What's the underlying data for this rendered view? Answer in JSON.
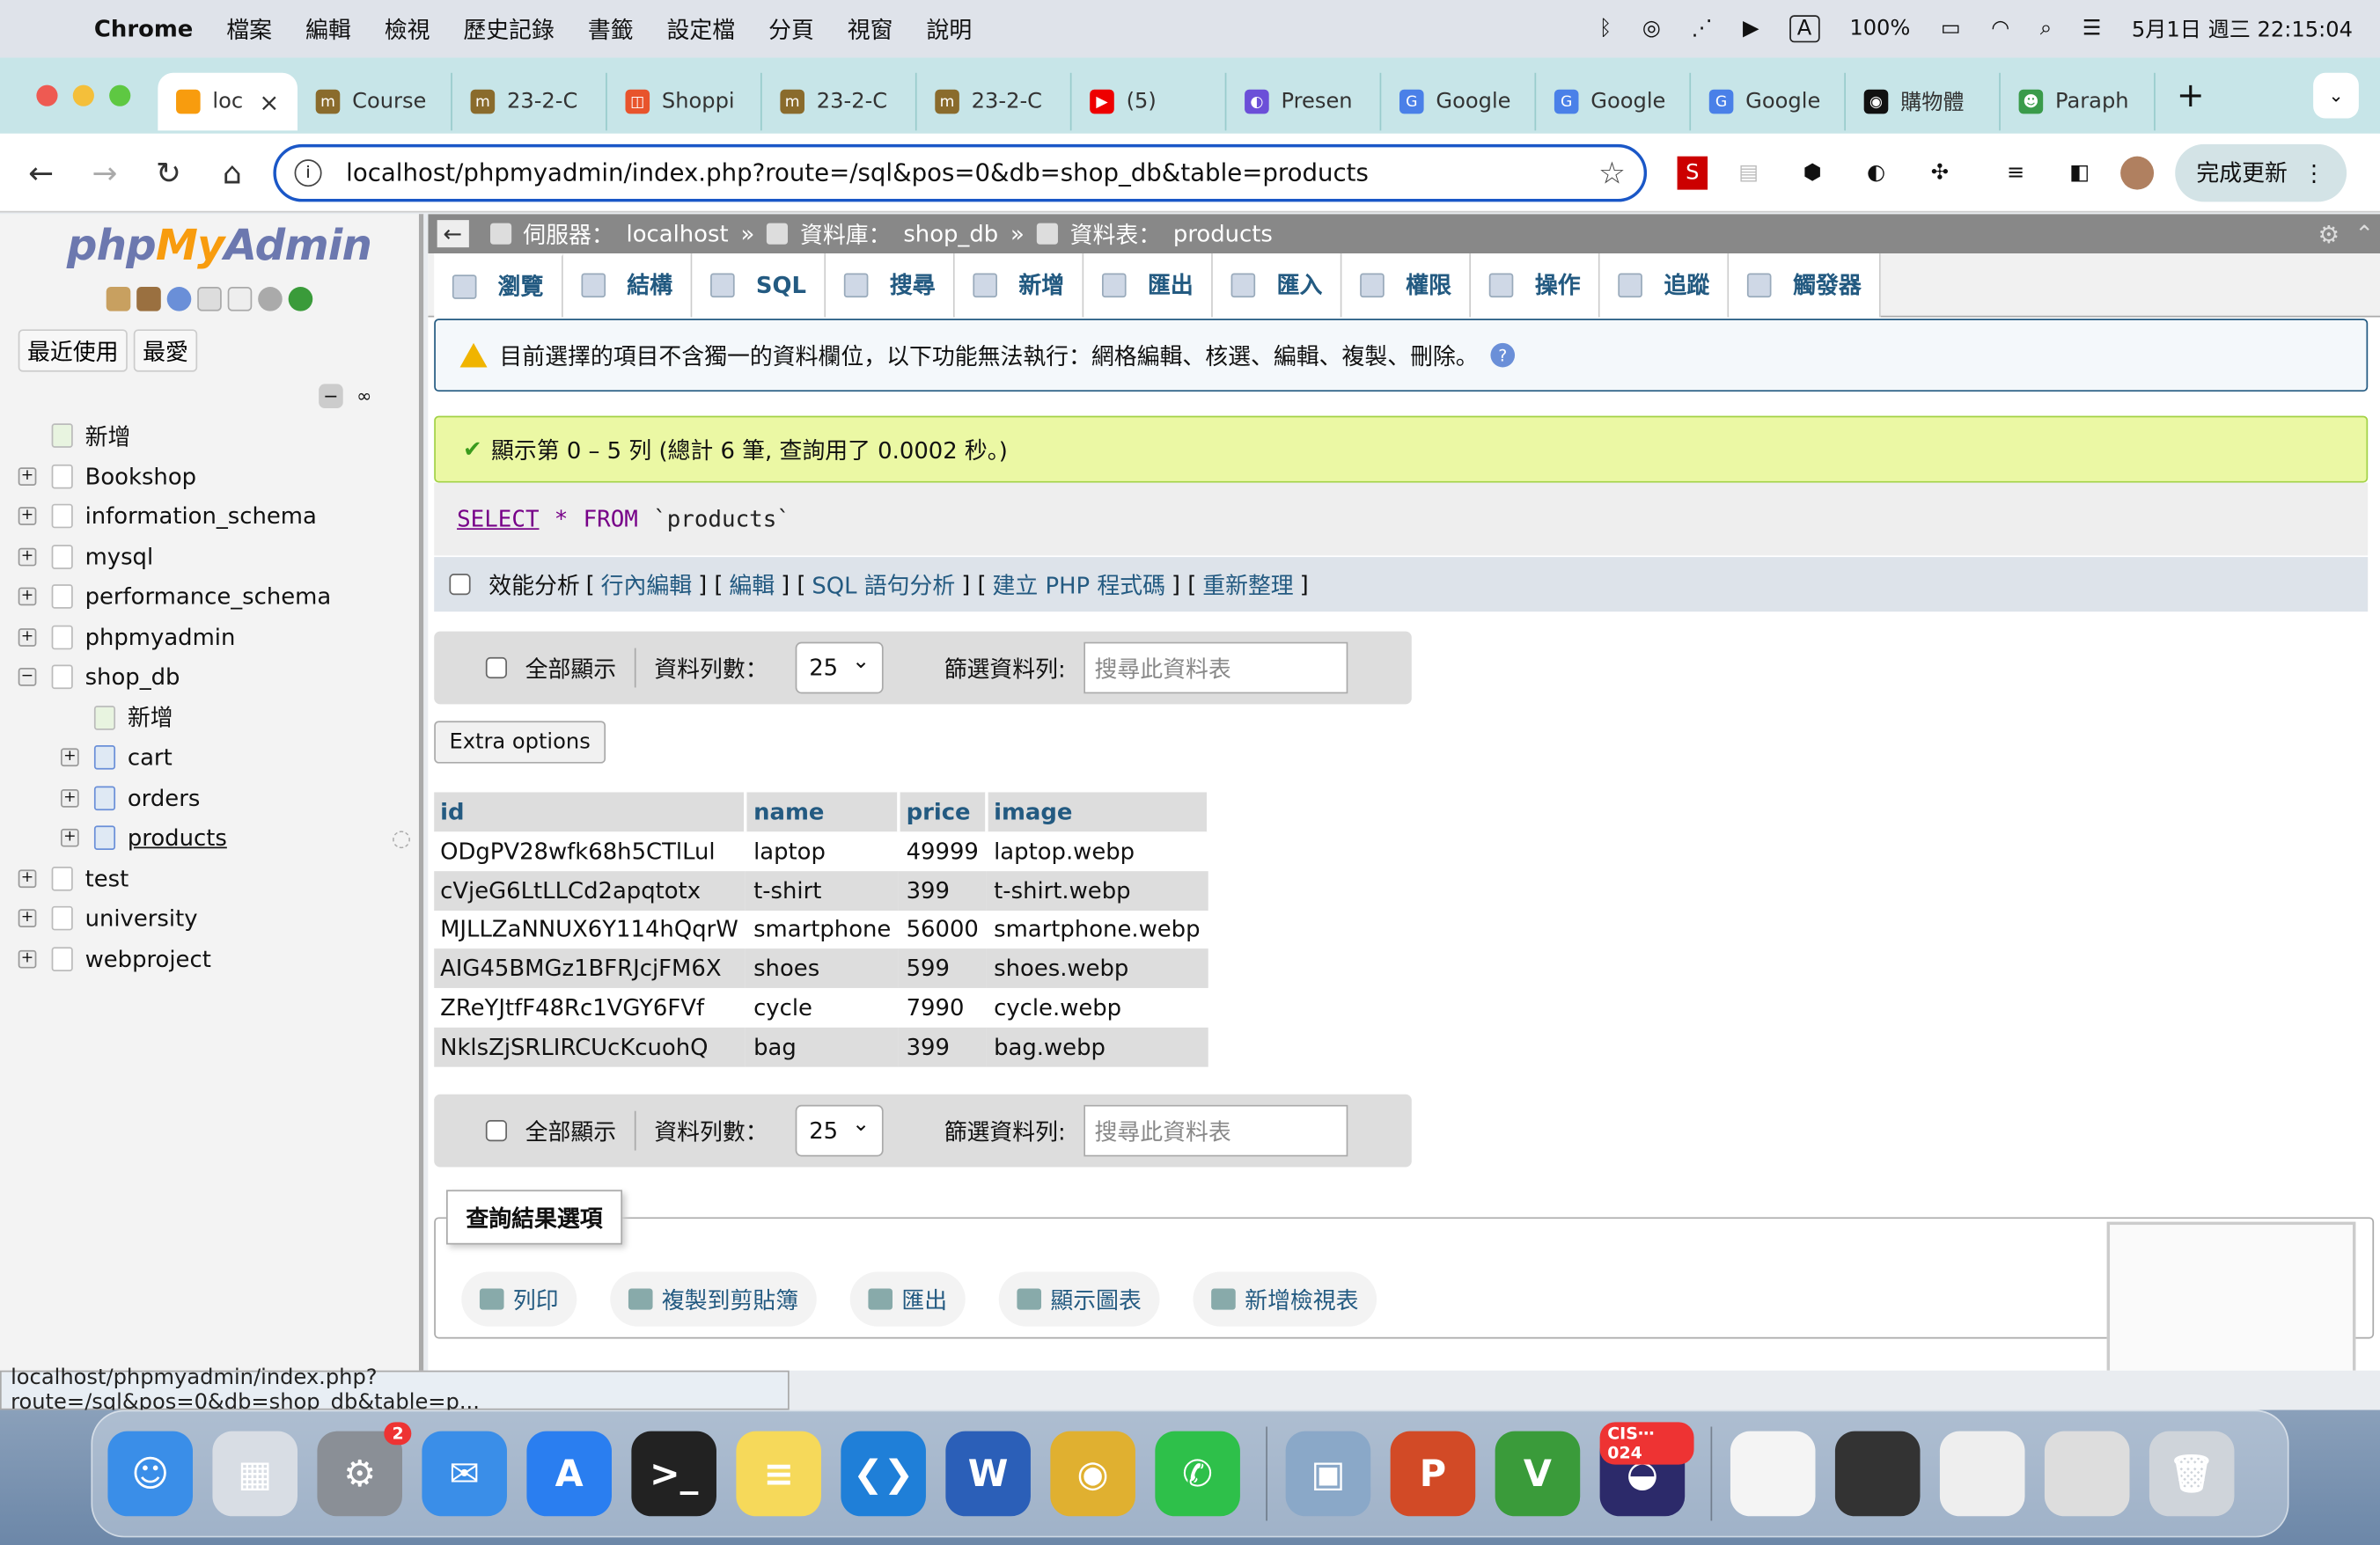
{
  "menubar": {
    "app": "Chrome",
    "items": [
      "檔案",
      "編輯",
      "檢視",
      "歷史記錄",
      "書籤",
      "設定檔",
      "分頁",
      "視窗",
      "說明"
    ],
    "battery": "100%",
    "input_mode": "A",
    "datetime": "5月1日 週三 22:15:04"
  },
  "tabs": [
    {
      "label": "loc",
      "active": true,
      "color": "#f89c0e",
      "glyph": "PMA"
    },
    {
      "label": "Course",
      "color": "#8a6b2c",
      "glyph": "m"
    },
    {
      "label": "23-2-C",
      "color": "#8a6b2c",
      "glyph": "m"
    },
    {
      "label": "Shoppi",
      "color": "#e8542c",
      "glyph": "◫"
    },
    {
      "label": "23-2-C",
      "color": "#8a6b2c",
      "glyph": "m"
    },
    {
      "label": "23-2-C",
      "color": "#8a6b2c",
      "glyph": "m"
    },
    {
      "label": "(5)",
      "color": "#e00",
      "glyph": "▶"
    },
    {
      "label": "Presen",
      "color": "#6b4fd8",
      "glyph": "◐"
    },
    {
      "label": "Google",
      "color": "#4a80e8",
      "glyph": "G"
    },
    {
      "label": "Google",
      "color": "#4a80e8",
      "glyph": "G"
    },
    {
      "label": "Google",
      "color": "#4a80e8",
      "glyph": "G"
    },
    {
      "label": "購物體",
      "color": "#111",
      "glyph": "◉"
    },
    {
      "label": "Paraph",
      "color": "#3a9b4a",
      "glyph": "☻"
    }
  ],
  "toolbar": {
    "url": "localhost/phpmyadmin/index.php?route=/sql&pos=0&db=shop_db&table=products",
    "update_label": "完成更新"
  },
  "sidebar": {
    "logo_a": "php",
    "logo_b": "My",
    "logo_c": "Admin",
    "tab_recent": "最近使用",
    "tab_fav": "最愛",
    "tree": [
      {
        "label": "新增",
        "level": 0,
        "exp": "",
        "new": true
      },
      {
        "label": "Bookshop",
        "level": 0,
        "exp": "+"
      },
      {
        "label": "information_schema",
        "level": 0,
        "exp": "+"
      },
      {
        "label": "mysql",
        "level": 0,
        "exp": "+"
      },
      {
        "label": "performance_schema",
        "level": 0,
        "exp": "+"
      },
      {
        "label": "phpmyadmin",
        "level": 0,
        "exp": "+"
      },
      {
        "label": "shop_db",
        "level": 0,
        "exp": "−"
      },
      {
        "label": "新增",
        "level": 1,
        "exp": "",
        "new": true
      },
      {
        "label": "cart",
        "level": 1,
        "exp": "+",
        "table": true
      },
      {
        "label": "orders",
        "level": 1,
        "exp": "+",
        "table": true
      },
      {
        "label": "products",
        "level": 1,
        "exp": "+",
        "table": true,
        "selected": true
      },
      {
        "label": "test",
        "level": 0,
        "exp": "+"
      },
      {
        "label": "university",
        "level": 0,
        "exp": "+"
      },
      {
        "label": "webproject",
        "level": 0,
        "exp": "+"
      }
    ]
  },
  "breadcrumb": {
    "server_label": "伺服器：",
    "server": "localhost",
    "db_label": "資料庫：",
    "db": "shop_db",
    "table_label": "資料表：",
    "table": "products"
  },
  "topmenu": [
    "瀏覽",
    "結構",
    "SQL",
    "搜尋",
    "新增",
    "匯出",
    "匯入",
    "權限",
    "操作",
    "追蹤",
    "觸發器"
  ],
  "notice": "目前選擇的項目不含獨一的資料欄位，以下功能無法執行：網格編輯、核選、編輯、複製、刪除。",
  "success": "顯示第 0 – 5 列 (總計 6 筆, 查詢用了 0.0002 秒。)",
  "sql": {
    "kw": "SELECT",
    "star": "*",
    "from": "FROM",
    "table": "`products`"
  },
  "sqlopts": {
    "profiling": "效能分析",
    "inline_edit": "行內編輯",
    "edit": "編輯",
    "explain": "SQL 語句分析",
    "php": "建立 PHP 程式碼",
    "refresh": "重新整理"
  },
  "nav": {
    "show_all": "全部顯示",
    "rows_label": "資料列數：",
    "rows_value": "25",
    "filter_label": "篩選資料列:",
    "filter_placeholder": "搜尋此資料表"
  },
  "extra_options": "Extra options",
  "table": {
    "columns": [
      "id",
      "name",
      "price",
      "image"
    ],
    "rows": [
      [
        "ODgPV28wfk68h5CTlLul",
        "laptop",
        "49999",
        "laptop.webp"
      ],
      [
        "cVjeG6LtLLCd2apqtotx",
        "t-shirt",
        "399",
        "t-shirt.webp"
      ],
      [
        "MJLLZaNNUX6Y114hQqrW",
        "smartphone",
        "56000",
        "smartphone.webp"
      ],
      [
        "AIG45BMGz1BFRJcjFM6X",
        "shoes",
        "599",
        "shoes.webp"
      ],
      [
        "ZReYJtfF48Rc1VGY6FVf",
        "cycle",
        "7990",
        "cycle.webp"
      ],
      [
        "NklsZjSRLIRCUcKcuohQ",
        "bag",
        "399",
        "bag.webp"
      ]
    ]
  },
  "query_results": {
    "legend": "查詢結果選項",
    "ops": [
      "列印",
      "複製到剪貼簿",
      "匯出",
      "顯示圖表",
      "新增檢視表"
    ]
  },
  "statusbar": "localhost/phpmyadmin/index.php?route=/sql&pos=0&db=shop_db&table=p...",
  "dock": [
    {
      "name": "finder",
      "color": "#3a8ee8",
      "glyph": "☺"
    },
    {
      "name": "launchpad",
      "color": "#d8dde4",
      "glyph": "▦"
    },
    {
      "name": "system-settings",
      "color": "#8a8f96",
      "glyph": "⚙",
      "badge": "2"
    },
    {
      "name": "mail",
      "color": "#3a8ee8",
      "glyph": "✉"
    },
    {
      "name": "app-store",
      "color": "#2a7ef0",
      "glyph": "A"
    },
    {
      "name": "terminal",
      "color": "#222",
      "glyph": ">_"
    },
    {
      "name": "notes",
      "color": "#f6d95a",
      "glyph": "≡"
    },
    {
      "name": "vscode",
      "color": "#1f7fd8",
      "glyph": "❮❯"
    },
    {
      "name": "word",
      "color": "#2b5fb8",
      "glyph": "W"
    },
    {
      "name": "chrome",
      "color": "#e0b030",
      "glyph": "◉"
    },
    {
      "name": "wechat",
      "color": "#2ec04a",
      "glyph": "✆"
    },
    {
      "name": "preview",
      "color": "#8aa8c8",
      "glyph": "▣",
      "sep": true
    },
    {
      "name": "powerpoint",
      "color": "#d24a26",
      "glyph": "P"
    },
    {
      "name": "vim",
      "color": "#3a9b3a",
      "glyph": "V"
    },
    {
      "name": "eclipse",
      "color": "#2c2a6a",
      "glyph": "◒",
      "badge": "CIS⋯024"
    },
    {
      "name": "window-1",
      "color": "#f4f4f4",
      "glyph": "",
      "sep": true
    },
    {
      "name": "window-2",
      "color": "#333",
      "glyph": ""
    },
    {
      "name": "window-3",
      "color": "#eee",
      "glyph": ""
    },
    {
      "name": "window-4",
      "color": "#ddd",
      "glyph": ""
    },
    {
      "name": "trash",
      "color": "#cfd4da",
      "glyph": "🗑"
    }
  ]
}
